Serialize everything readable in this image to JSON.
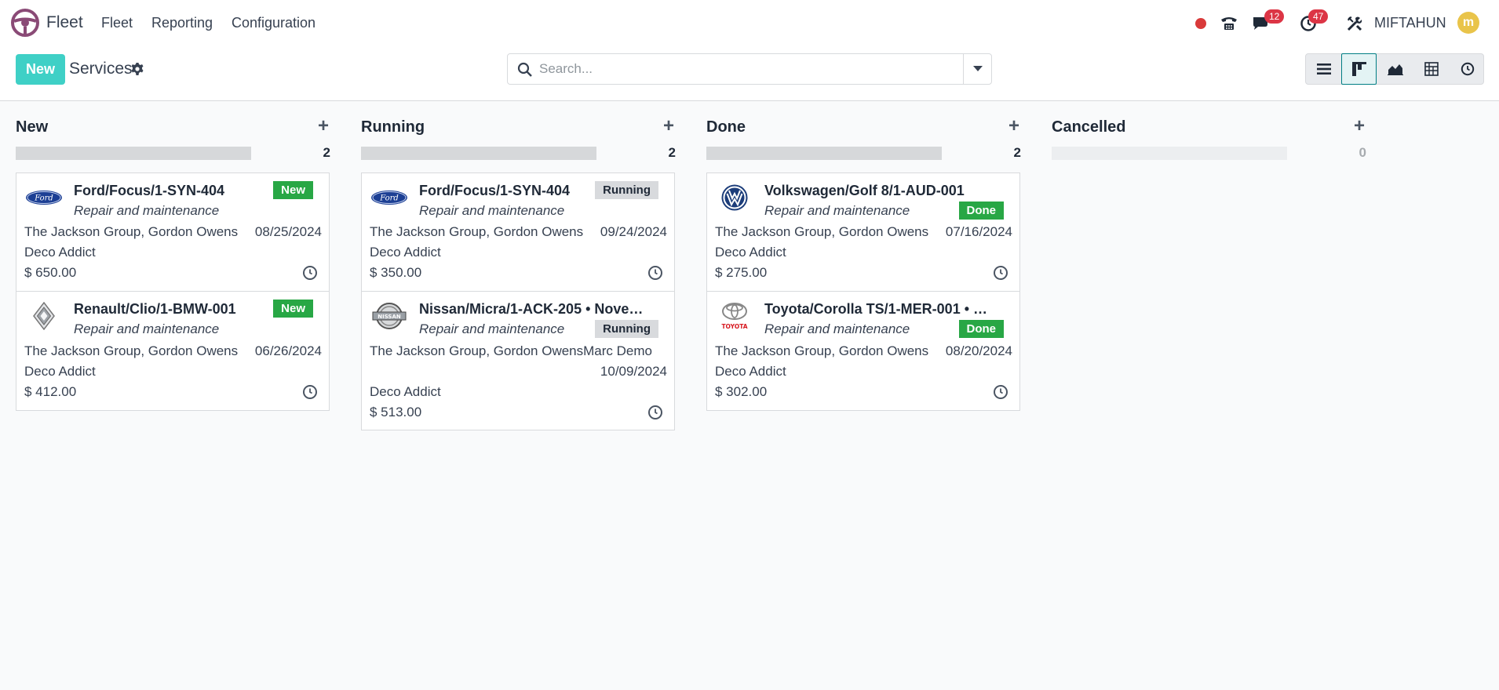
{
  "app": {
    "name": "Fleet"
  },
  "menu": {
    "fleet": "Fleet",
    "reporting": "Reporting",
    "configuration": "Configuration"
  },
  "systray": {
    "messages_count": "12",
    "activities_count": "47",
    "user_name": "MIFTAHUN",
    "avatar_letter": "m"
  },
  "control": {
    "new_label": "New",
    "breadcrumb": "Services",
    "search_placeholder": "Search..."
  },
  "columns": [
    {
      "title": "New",
      "count": "2"
    },
    {
      "title": "Running",
      "count": "2"
    },
    {
      "title": "Done",
      "count": "2"
    },
    {
      "title": "Cancelled",
      "count": "0"
    }
  ],
  "cards": {
    "new": [
      {
        "title": "Ford/Focus/1-SYN-404",
        "type": "Repair and maintenance",
        "status": "New",
        "customer": "The Jackson Group, Gordon Owens",
        "date": "08/25/2024",
        "vendor": "Deco Addict",
        "amount": "$ 650.00",
        "brand_icon": "ford-logo"
      },
      {
        "title": "Renault/Clio/1-BMW-001",
        "type": "Repair and maintenance",
        "status": "New",
        "customer": "The Jackson Group, Gordon Owens",
        "date": "06/26/2024",
        "vendor": "Deco Addict",
        "amount": "$ 412.00",
        "brand_icon": "renault-logo"
      }
    ],
    "running": [
      {
        "title": "Ford/Focus/1-SYN-404",
        "type": "Repair and maintenance",
        "status": "Running",
        "customer": "The Jackson Group, Gordon Owens",
        "date": "09/24/2024",
        "vendor": "Deco Addict",
        "amount": "$ 350.00",
        "brand_icon": "ford-logo"
      },
      {
        "title": "Nissan/Micra/1-ACK-205 • Novem...",
        "type": "Repair and maintenance",
        "status": "Running",
        "customer": "The Jackson Group, Gordon OwensMarc Demo",
        "date": "10/09/2024",
        "vendor": "Deco Addict",
        "amount": "$ 513.00",
        "brand_icon": "nissan-logo"
      }
    ],
    "done": [
      {
        "title": "Volkswagen/Golf 8/1-AUD-001",
        "type": "Repair and maintenance",
        "status": "Done",
        "customer": "The Jackson Group, Gordon Owens",
        "date": "07/16/2024",
        "vendor": "Deco Addict",
        "amount": "$ 275.00",
        "brand_icon": "volkswagen-logo"
      },
      {
        "title": "Toyota/Corolla TS/1-MER-001 • Oct...",
        "type": "Repair and maintenance",
        "status": "Done",
        "customer": "The Jackson Group, Gordon Owens",
        "date": "08/20/2024",
        "vendor": "Deco Addict",
        "amount": "$ 302.00",
        "brand_icon": "toyota-logo",
        "brand_text": "TOYOTA"
      }
    ]
  },
  "colors": {
    "primary": "#3fd0c6",
    "done_tag": "#28a745",
    "active_view": "#017e84",
    "badge": "#dc3545"
  }
}
